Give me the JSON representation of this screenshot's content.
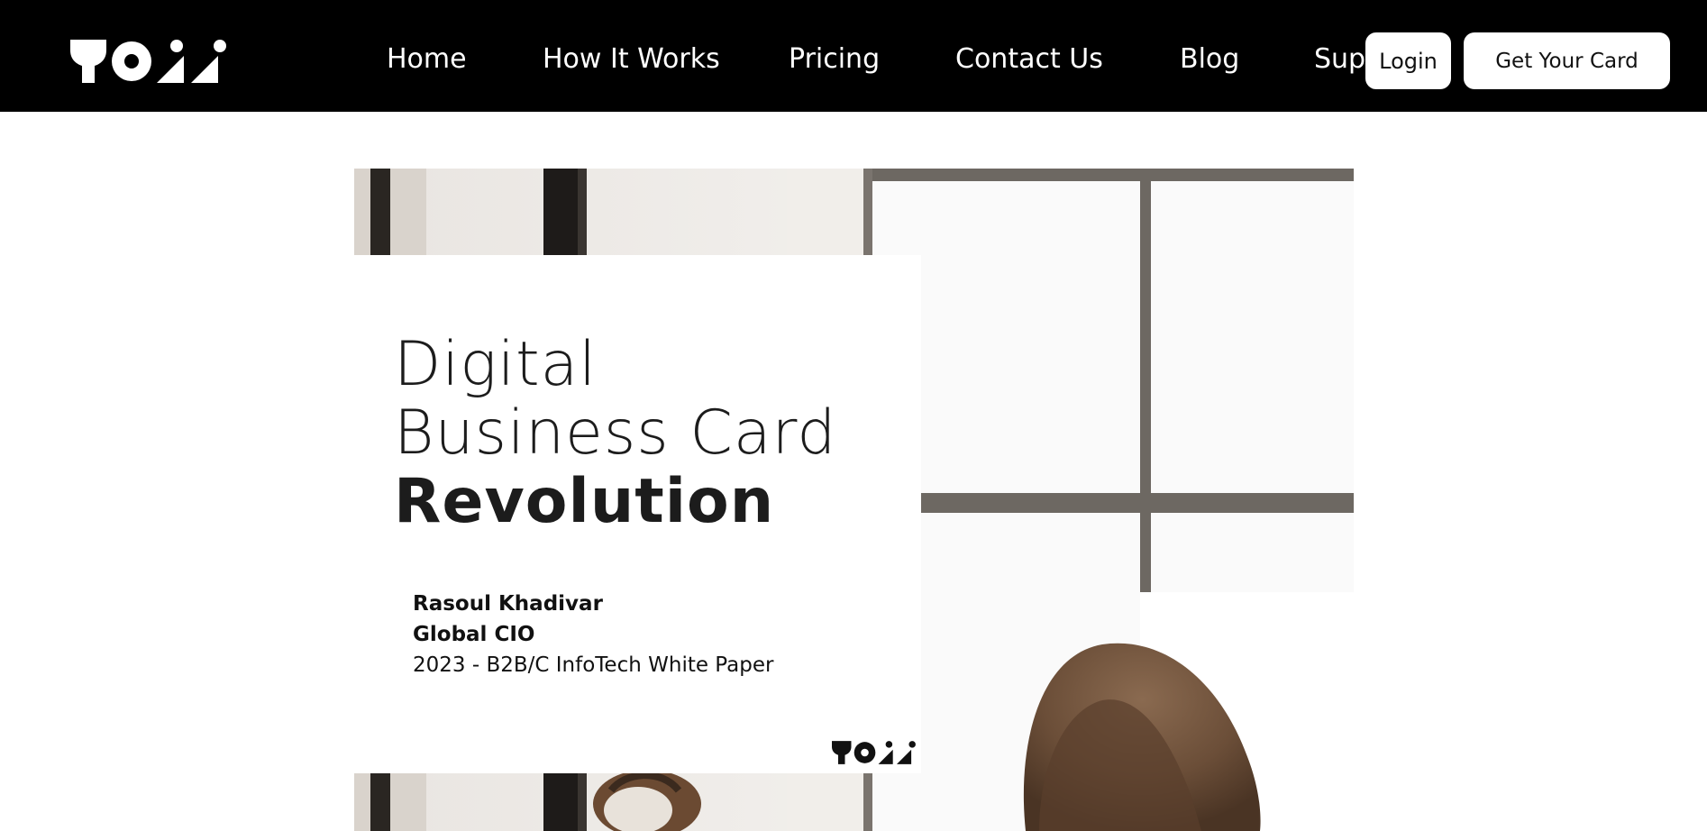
{
  "brand": {
    "logo_text": "YOLLI"
  },
  "nav": {
    "items": [
      {
        "label": "Home"
      },
      {
        "label": "How It Works"
      },
      {
        "label": "Pricing"
      },
      {
        "label": "Contact Us"
      },
      {
        "label": "Blog"
      },
      {
        "label": "Sup"
      }
    ]
  },
  "header_actions": {
    "login_label": "Login",
    "cta_label": "Get Your Card"
  },
  "hero": {
    "headline_line1": "Digital",
    "headline_line2": "Business Card",
    "headline_line3": "Revolution",
    "author_name": "Rasoul Khadivar",
    "author_title": "Global CIO",
    "publication": "2023 - B2B/C InfoTech White Paper"
  },
  "colors": {
    "topbar": "#000000",
    "button_bg": "#ffffff",
    "text_dark": "#1c1c1c"
  }
}
